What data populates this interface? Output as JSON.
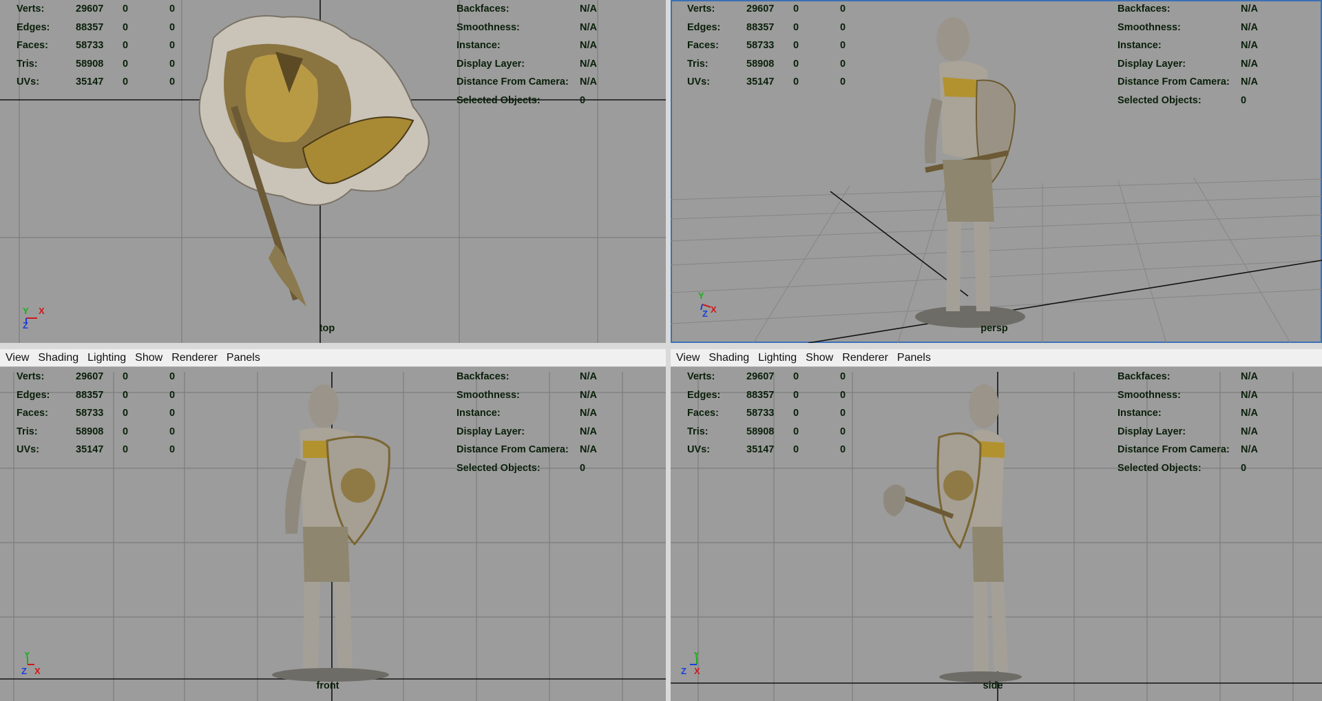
{
  "menu": [
    "View",
    "Shading",
    "Lighting",
    "Show",
    "Renderer",
    "Panels"
  ],
  "stats": [
    {
      "label": "Verts:",
      "value": "29607",
      "a": "0",
      "b": "0"
    },
    {
      "label": "Edges:",
      "value": "88357",
      "a": "0",
      "b": "0"
    },
    {
      "label": "Faces:",
      "value": "58733",
      "a": "0",
      "b": "0"
    },
    {
      "label": "Tris:",
      "value": "58908",
      "a": "0",
      "b": "0"
    },
    {
      "label": "UVs:",
      "value": "35147",
      "a": "0",
      "b": "0"
    }
  ],
  "info": [
    {
      "label": "Backfaces:",
      "value": "N/A"
    },
    {
      "label": "Smoothness:",
      "value": "N/A"
    },
    {
      "label": "Instance:",
      "value": "N/A"
    },
    {
      "label": "Display Layer:",
      "value": "N/A"
    },
    {
      "label": "Distance From Camera:",
      "value": "N/A"
    },
    {
      "label": "Selected Objects:",
      "value": "0"
    }
  ],
  "cameras": {
    "top": "top",
    "persp": "persp",
    "front": "front",
    "side": "side"
  },
  "colors": {
    "viewport_bg": "#9c9c9c",
    "grid": "#7d7d7d",
    "hud_text": "#0a1f0a",
    "selection_border": "#3c6fb5",
    "axis_x": "#d01818",
    "axis_y": "#18b018",
    "axis_z": "#1a3fd8"
  },
  "axis_labels": {
    "x": "X",
    "y": "Y",
    "z": "Z"
  },
  "icons": [
    "axis-gizmo-icon"
  ]
}
